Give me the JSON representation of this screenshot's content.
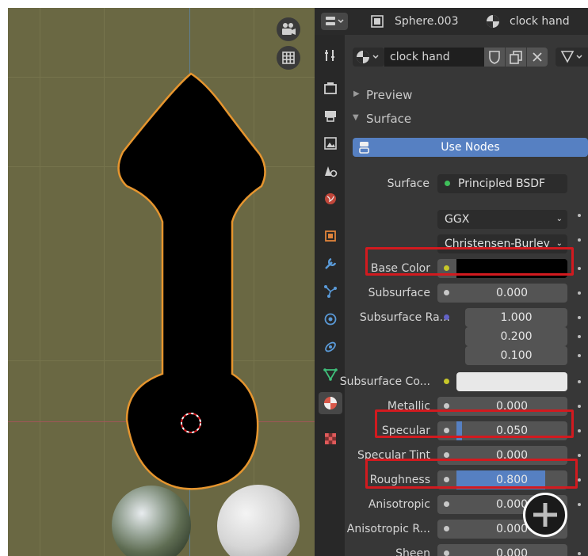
{
  "header": {
    "object_name": "Sphere.003",
    "material_tab": "clock hand"
  },
  "material_slot": {
    "name": "clock hand"
  },
  "panels": {
    "preview": "Preview",
    "surface": "Surface"
  },
  "use_nodes_label": "Use Nodes",
  "surface_row": {
    "label": "Surface",
    "shader": "Principled BSDF"
  },
  "distribution": "GGX",
  "subsurface_method": "Christensen-Burley",
  "properties": {
    "base_color": {
      "label": "Base Color"
    },
    "subsurface": {
      "label": "Subsurface",
      "value": "0.000",
      "fill": 0
    },
    "subsurface_radius": {
      "label": "Subsurface Ra...",
      "values": [
        "1.000",
        "0.200",
        "0.100"
      ]
    },
    "subsurface_color": {
      "label": "Subsurface Co..."
    },
    "metallic": {
      "label": "Metallic",
      "value": "0.000",
      "fill": 0
    },
    "specular": {
      "label": "Specular",
      "value": "0.050",
      "fill": 0.05
    },
    "specular_tint": {
      "label": "Specular Tint",
      "value": "0.000",
      "fill": 0
    },
    "roughness": {
      "label": "Roughness",
      "value": "0.800",
      "fill": 0.8
    },
    "anisotropic": {
      "label": "Anisotropic",
      "value": "0.000",
      "fill": 0
    },
    "anisotropic_rotation": {
      "label": "Anisotropic R...",
      "value": "0.000",
      "fill": 0
    },
    "sheen": {
      "label": "Sheen",
      "value": "0.000",
      "fill": 0
    }
  },
  "colors": {
    "viewport_bg": "#6a6843",
    "selection_outline": "#e6952e",
    "base_color": "#000000",
    "subsurface_color": "#e8e8e8",
    "use_nodes_bg": "#5680c2",
    "value_fill": "#5680c2",
    "highlight_box": "#d21a1f"
  },
  "icons": {
    "camera": "camera-icon",
    "grid": "grid-icon",
    "add": "add-icon"
  }
}
